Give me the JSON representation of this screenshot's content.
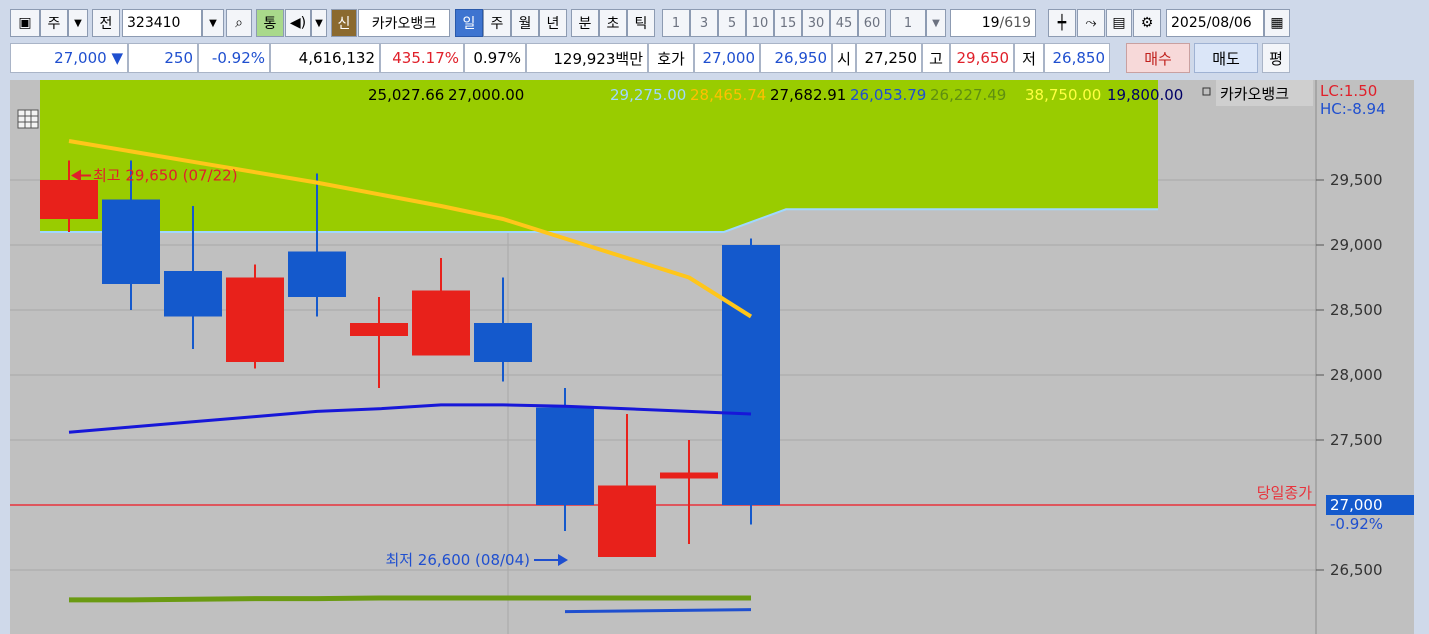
{
  "toolbar": {
    "market": "주",
    "prev_label": "전",
    "code": "323410",
    "tong": "통",
    "new": "신",
    "name": "카카오뱅크",
    "periods": [
      "일",
      "주",
      "월",
      "년",
      "분",
      "초",
      "틱"
    ],
    "active_period": "일",
    "intervals": [
      "1",
      "3",
      "5",
      "10",
      "15",
      "30",
      "45",
      "60"
    ],
    "interval_value": "1",
    "page_current": "19",
    "page_total": "/619",
    "date": "2025/08/06"
  },
  "quote": {
    "price": "27,000",
    "change_arrow": "▼",
    "change": "250",
    "change_pct": "-0.92%",
    "volume": "4,616,132",
    "volume_ratio": "435.17%",
    "turnover": "0.97%",
    "amount": "129,923백만",
    "hoga_label": "호가",
    "ask": "27,000",
    "bid": "26,950",
    "open_label": "시",
    "open": "27,250",
    "high_label": "고",
    "high": "29,650",
    "low_label": "저",
    "low": "26,850",
    "buy": "매수",
    "sell": "매도",
    "eval": "평"
  },
  "legend": {
    "values": [
      {
        "text": "25,027.66",
        "color": "#000000"
      },
      {
        "text": "27,000.00",
        "color": "#000000"
      },
      {
        "text": "29,275.00",
        "color": "#9fd8ff"
      },
      {
        "text": "28,465.74",
        "color": "#ffc000"
      },
      {
        "text": "27,682.91",
        "color": "#000000"
      },
      {
        "text": "26,053.79",
        "color": "#1f4fcf"
      },
      {
        "text": "26,227.49",
        "color": "#5f8f10"
      },
      {
        "text": "38,750.00",
        "color": "#ffff40"
      },
      {
        "text": "19,800.00",
        "color": "#000066"
      }
    ],
    "name": "카카오뱅크",
    "lc": "LC:1.50",
    "hc": "HC:-8.94"
  },
  "chart_data": {
    "type": "candlestick",
    "title": "카카오뱅크",
    "y_ticks": [
      "29,500",
      "29,000",
      "28,500",
      "28,000",
      "27,500",
      "26,500"
    ],
    "y_tick_values": [
      29500,
      29000,
      28500,
      28000,
      27500,
      26500
    ],
    "candles": [
      {
        "open": 29200,
        "high": 29650,
        "low": 29100,
        "close": 29500
      },
      {
        "open": 29350,
        "high": 29650,
        "low": 28500,
        "close": 28700
      },
      {
        "open": 28800,
        "high": 29300,
        "low": 28200,
        "close": 28450
      },
      {
        "open": 28100,
        "high": 28850,
        "low": 28050,
        "close": 28750
      },
      {
        "open": 28950,
        "high": 29550,
        "low": 28450,
        "close": 28600
      },
      {
        "open": 28300,
        "high": 28600,
        "low": 27900,
        "close": 28400
      },
      {
        "open": 28150,
        "high": 28900,
        "low": 28150,
        "close": 28650
      },
      {
        "open": 28400,
        "high": 28750,
        "low": 27950,
        "close": 28100
      },
      {
        "open": 27750,
        "high": 27900,
        "low": 26800,
        "close": 27000
      },
      {
        "open": 26600,
        "high": 27700,
        "low": 26600,
        "close": 27150
      },
      {
        "open": 27250,
        "high": 27500,
        "low": 26700,
        "close": 27250
      },
      {
        "open": 29000,
        "high": 29050,
        "low": 26850,
        "close": 27000
      }
    ],
    "ma_yellow": [
      29800,
      29720,
      29640,
      29560,
      29480,
      29390,
      29300,
      29200,
      29050,
      28900,
      28750,
      28450
    ],
    "ma_blue": [
      27560,
      27600,
      27640,
      27680,
      27720,
      27740,
      27770,
      27770,
      27760,
      27740,
      27720,
      27700
    ],
    "ma_green": [
      26270,
      26270,
      26275,
      26280,
      26280,
      26285,
      26285,
      26285,
      26285,
      26285,
      26285,
      26285
    ],
    "cloud_top": 30800,
    "cloud_bottom_start": 29100,
    "cloud_bottom_end": 29275,
    "current_price": 27000,
    "current_label": "당일종가",
    "current_tag": "27,000",
    "current_pct": "-0.92%",
    "annotations": [
      {
        "text": "최고 29,650 (07/22)",
        "color": "#e0202a",
        "value": 29650
      },
      {
        "text": "최저 26,600 (08/04)",
        "color": "#1f4fcf",
        "value": 26600
      }
    ],
    "colors": {
      "up": "#e8211b",
      "down": "#1459cc",
      "cloud": "#99cc00",
      "yellow": "#ffc61a",
      "blue": "#1717d8",
      "green": "#6a9a12",
      "bg": "#c0c0c0"
    }
  }
}
